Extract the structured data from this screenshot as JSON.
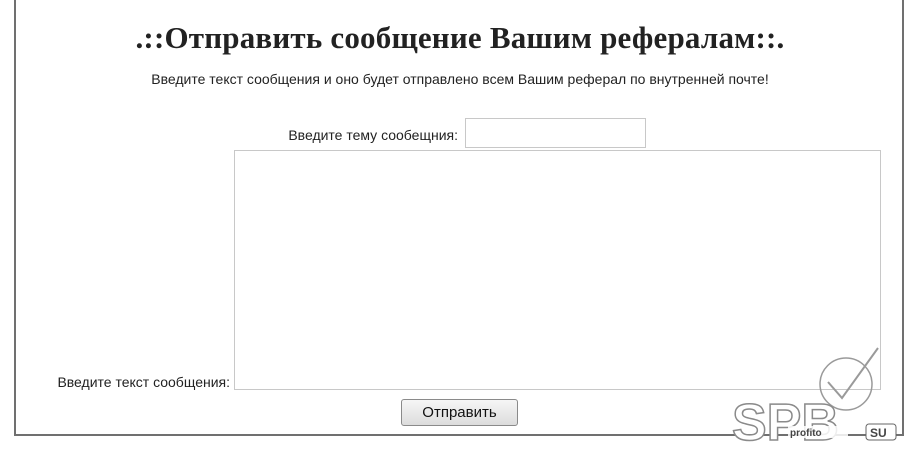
{
  "page": {
    "title": ".::Отправить сообщение Вашим рефералам::.",
    "subtitle": "Введите текст сообщения и оно будет отправлено всем Вашим реферал по внутренней почте!"
  },
  "form": {
    "subject_label": "Введите тему сообещния:",
    "subject_value": "",
    "message_label": "Введите текст сообщения:",
    "message_value": "",
    "submit_label": "Отправить"
  },
  "watermark": {
    "text": "SPB",
    "domain": "SU",
    "small_text": "profito",
    "icon": "checkmark-logo-icon"
  },
  "colors": {
    "border": "#707070",
    "input_border": "#c8c8c8"
  }
}
